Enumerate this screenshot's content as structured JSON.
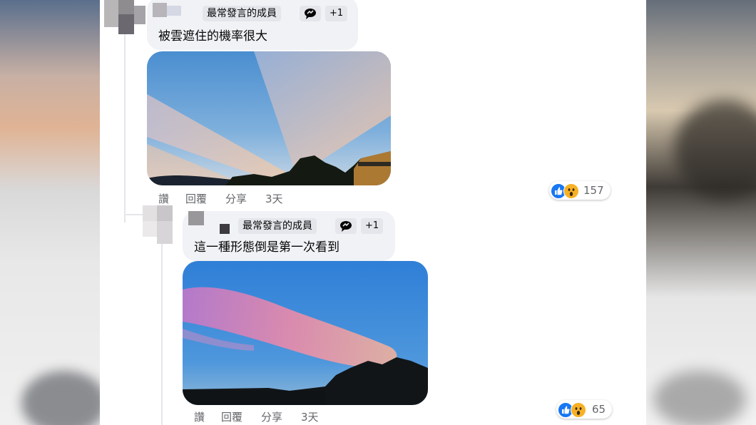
{
  "comments": [
    {
      "badge": "最常發言的成員",
      "badge_icon": "speech-bubble-icon",
      "extra": "+1",
      "text": "被雲遮住的機率很大",
      "image_description": "sky-rays-photo",
      "actions": {
        "like": "讚",
        "reply": "回覆",
        "share": "分享",
        "time": "3天"
      },
      "reactions": {
        "icons": [
          "like-icon",
          "wow-icon"
        ],
        "count": "157"
      }
    },
    {
      "badge": "最常發言的成員",
      "badge_icon": "speech-bubble-icon",
      "extra": "+1",
      "text": "這一種形態倒是第一次看到",
      "image_description": "pink-cloud-photo",
      "actions": {
        "like": "讚",
        "reply": "回覆",
        "share": "分享",
        "time": "3天"
      },
      "reactions": {
        "icons": [
          "like-icon",
          "wow-icon"
        ],
        "count": "65"
      }
    }
  ],
  "colors": {
    "bubble": "#f0f2f5",
    "badge": "#e4e6eb",
    "secondary_text": "#65676b",
    "like_blue": "#1877f2",
    "wow_yellow": "#f7b125"
  }
}
